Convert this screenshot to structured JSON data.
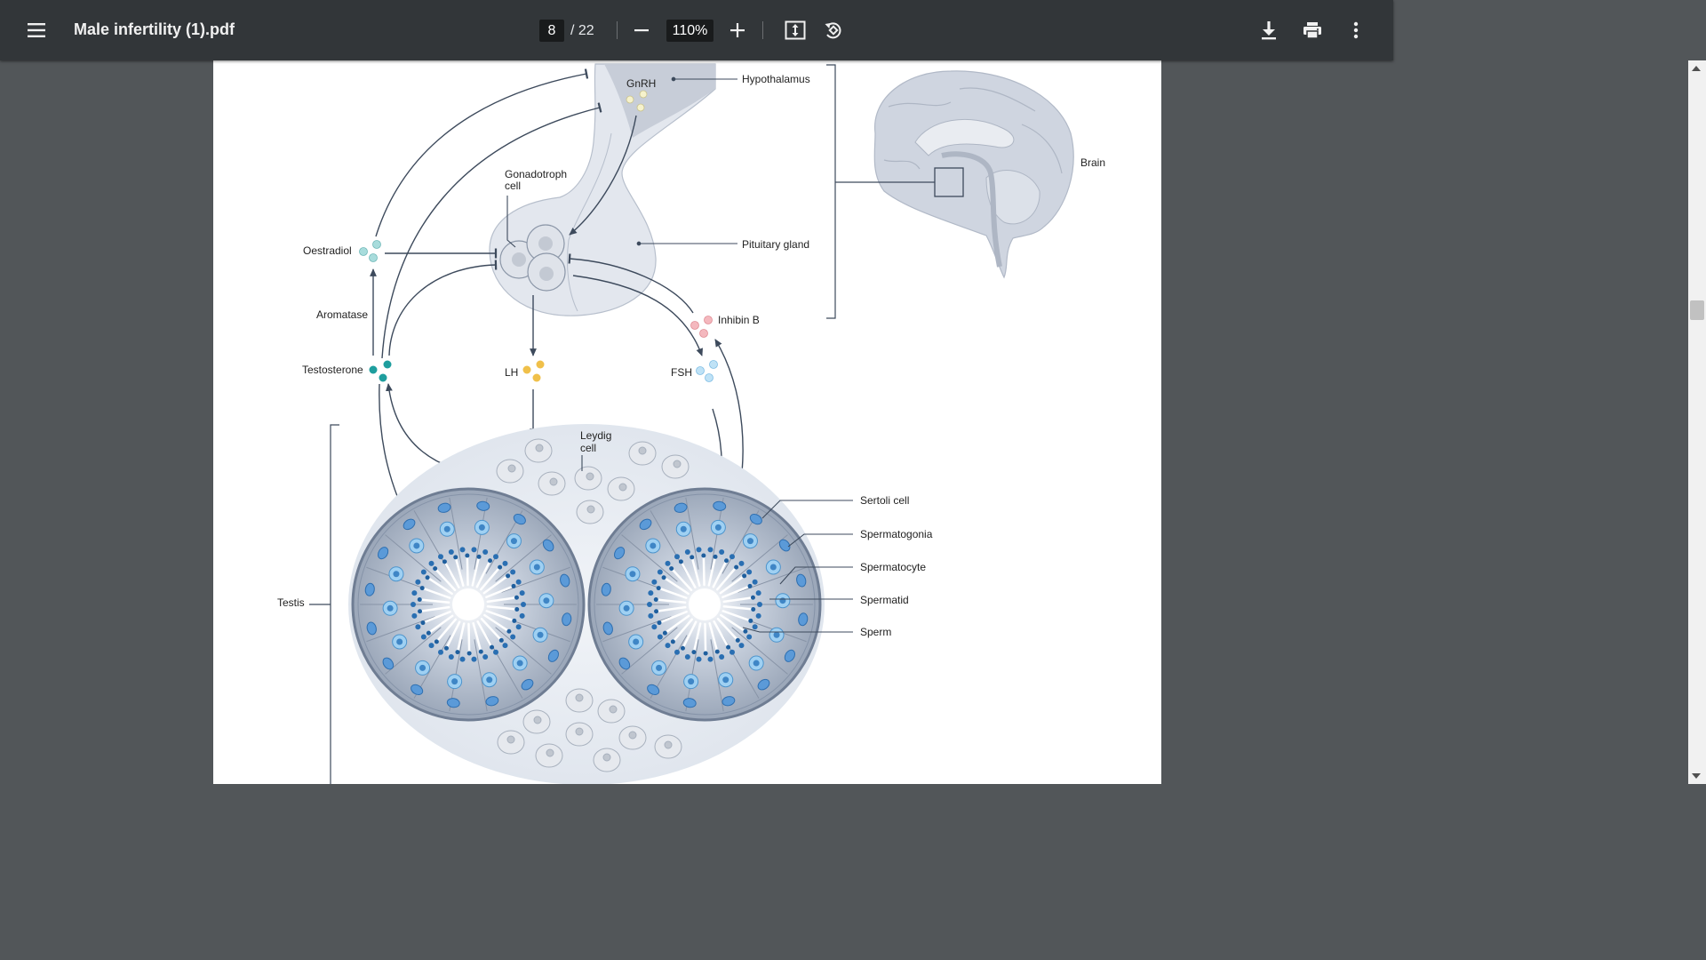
{
  "toolbar": {
    "title": "Male infertility (1).pdf",
    "current_page": "8",
    "total_pages": "/ 22",
    "zoom": "110%",
    "icons": {
      "menu": "hamburger-menu-icon",
      "zoom_out": "minus-icon",
      "zoom_in": "plus-icon",
      "fit": "fit-to-page-icon",
      "rotate": "rotate-icon",
      "download": "download-icon",
      "print": "print-icon",
      "more": "more-vertical-icon"
    }
  },
  "figure": {
    "labels": {
      "gnrh": "GnRH",
      "hypothalamus": "Hypothalamus",
      "brain": "Brain",
      "gonadotroph": "Gonadotroph",
      "gonadotroph2": "cell",
      "pituitary": "Pituitary gland",
      "oestradiol": "Oestradiol",
      "aromatase": "Aromatase",
      "inhibin": "Inhibin B",
      "testosterone": "Testosterone",
      "lh": "LH",
      "fsh": "FSH",
      "leydig": "Leydig",
      "leydig2": "cell",
      "sertoli": "Sertoli cell",
      "spermatogonia": "Spermatogonia",
      "spermatocyte": "Spermatocyte",
      "spermatid": "Spermatid",
      "sperm": "Sperm",
      "testis": "Testis"
    }
  },
  "colors": {
    "toolbar_bg": "#323639",
    "viewer_bg": "#525659",
    "arrow": "#3d4a5c",
    "oestradiol": "#9fd8d8",
    "testosterone": "#1e9e9e",
    "lh": "#f0c04a",
    "fsh": "#8cc8ee",
    "inhibin": "#f0a0a8",
    "tubule": "#5b89c9"
  }
}
